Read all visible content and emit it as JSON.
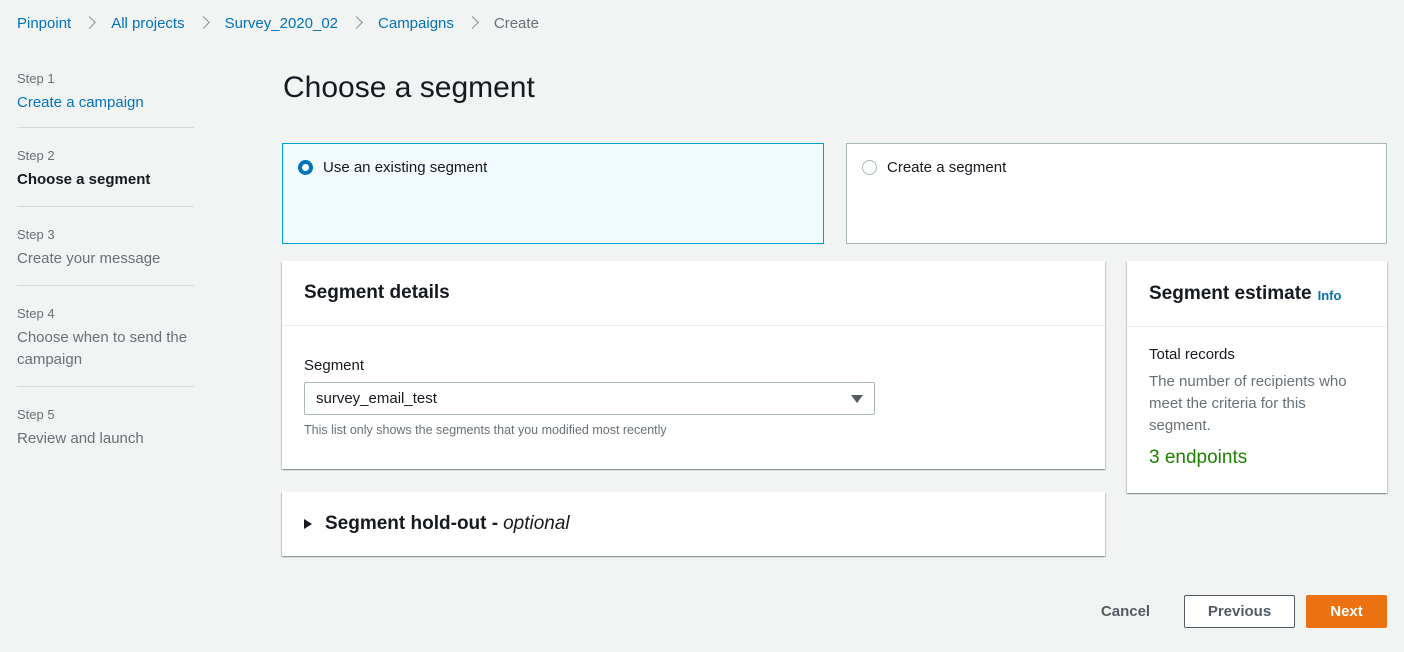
{
  "breadcrumbs": [
    {
      "label": "Pinpoint"
    },
    {
      "label": "All projects"
    },
    {
      "label": "Survey_2020_02"
    },
    {
      "label": "Campaigns"
    },
    {
      "label": "Create"
    }
  ],
  "steps": [
    {
      "num": "Step 1",
      "title": "Create a campaign",
      "state": "done"
    },
    {
      "num": "Step 2",
      "title": "Choose a segment",
      "state": "active"
    },
    {
      "num": "Step 3",
      "title": "Create your message",
      "state": "future"
    },
    {
      "num": "Step 4",
      "title": "Choose when to send the campaign",
      "state": "future"
    },
    {
      "num": "Step 5",
      "title": "Review and launch",
      "state": "future"
    }
  ],
  "page_title": "Choose a segment",
  "tiles": {
    "existing": {
      "label": "Use an existing segment",
      "selected": true
    },
    "create": {
      "label": "Create a segment",
      "selected": false
    }
  },
  "details": {
    "header": "Segment details",
    "field_label": "Segment",
    "selected_value": "survey_email_test",
    "hint": "This list only shows the segments that you modified most recently"
  },
  "estimate": {
    "header": "Segment estimate",
    "info": "Info",
    "label": "Total records",
    "description": "The number of recipients who meet the criteria for this segment.",
    "value": "3 endpoints"
  },
  "holdout": {
    "title": "Segment hold-out -",
    "optional": "optional"
  },
  "footer": {
    "cancel": "Cancel",
    "previous": "Previous",
    "next": "Next"
  },
  "colors": {
    "link": "#0073bb",
    "primary_button": "#ec7211",
    "estimate_value": "#1d8102",
    "selected_tile_bg": "#f1faff",
    "selected_tile_border": "#00a1c9"
  }
}
